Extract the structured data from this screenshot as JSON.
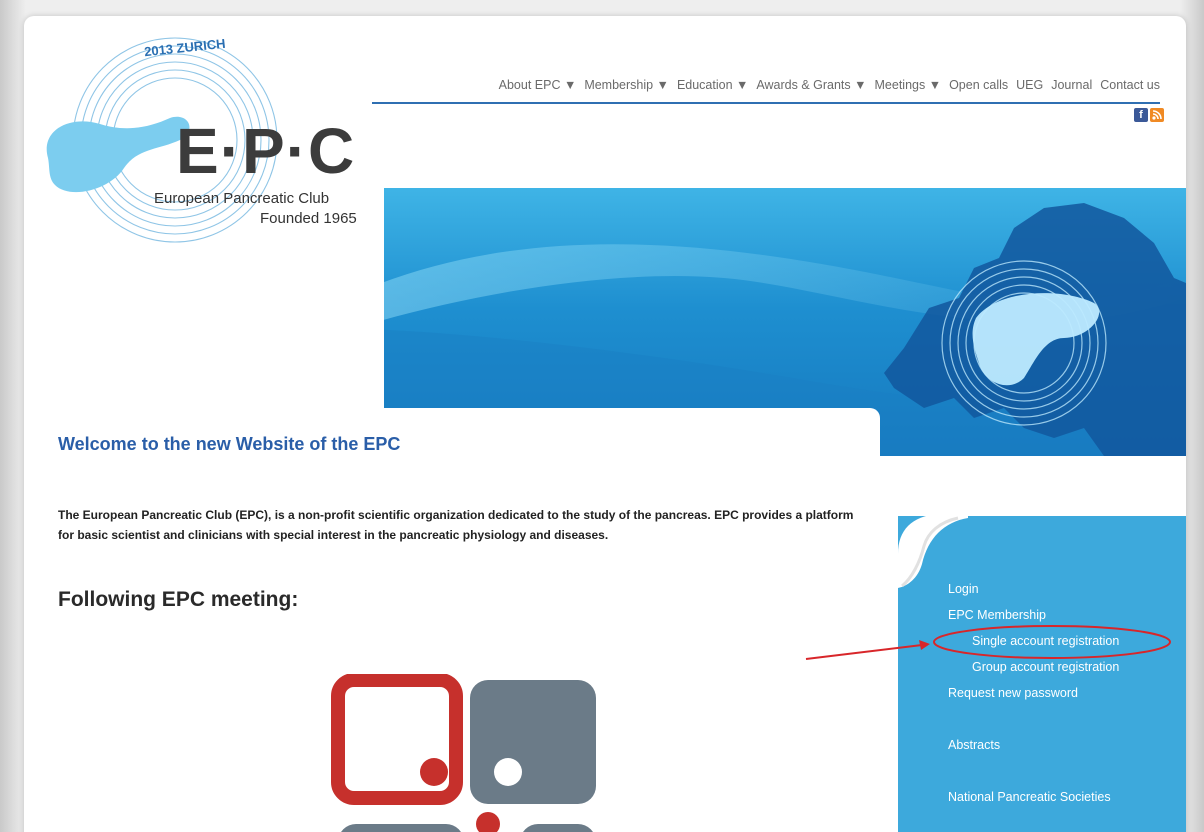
{
  "logo": {
    "name": "E·P·C",
    "organization": "European Pancreatic Club",
    "founded": "Founded 1965",
    "ring_text": "2013 ZURICH"
  },
  "nav": {
    "items": [
      {
        "label": "About EPC ▼"
      },
      {
        "label": "Membership ▼"
      },
      {
        "label": "Education ▼"
      },
      {
        "label": "Awards & Grants ▼"
      },
      {
        "label": "Meetings ▼"
      },
      {
        "label": "Open calls"
      },
      {
        "label": "UEG"
      },
      {
        "label": "Journal"
      },
      {
        "label": "Contact us"
      }
    ]
  },
  "social": {
    "facebook_icon": "facebook-icon",
    "rss_icon": "rss-icon"
  },
  "main": {
    "title": "Welcome to the new Website of the EPC",
    "intro": "The European Pancreatic Club (EPC), is a non-profit scientific organization dedicated to the study of the pancreas.  EPC provides a platform for basic scientist and clinicians with special interest in the pancreatic physiology and  diseases.",
    "meeting_heading": "Following EPC meeting:"
  },
  "sidebar": {
    "items": [
      {
        "label": "Login"
      },
      {
        "label": "EPC Membership"
      },
      {
        "label": "Single account registration"
      },
      {
        "label": "Group account registration"
      },
      {
        "label": "Request new password"
      },
      {
        "label": "Abstracts"
      },
      {
        "label": "National Pancreatic Societies"
      }
    ]
  },
  "colors": {
    "accent": "#2a5ea8",
    "banner": "#1e8fd0",
    "sidebar": "#3da9dc",
    "annotation": "#d8262a"
  }
}
